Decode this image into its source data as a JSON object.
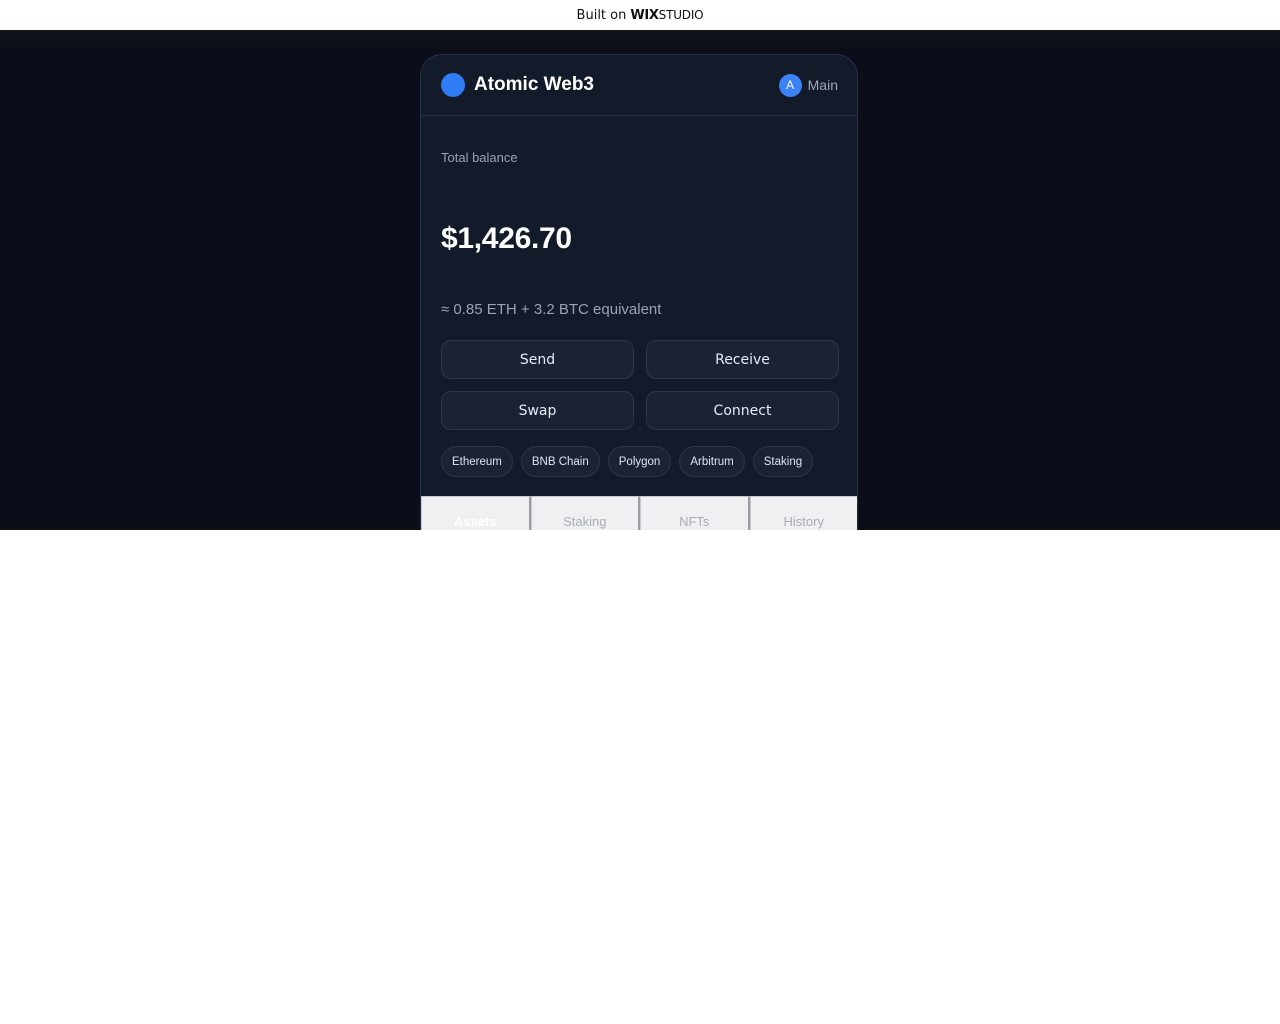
{
  "wix_bar": {
    "prefix": "Built on",
    "brand_bold": "WIX",
    "brand_light": "STUDIO"
  },
  "header": {
    "title": "Atomic Web3",
    "avatar_letter": "A",
    "account_label": "Main"
  },
  "balance": {
    "label": "Total balance",
    "value": "$1,426.70",
    "equivalent": "≈ 0.85 ETH + 3.2 BTC equivalent"
  },
  "actions": [
    "Send",
    "Receive",
    "Swap",
    "Connect"
  ],
  "chains": [
    "Ethereum",
    "BNB Chain",
    "Polygon",
    "Arbitrum",
    "Staking"
  ],
  "tabs": [
    {
      "label": "Assets",
      "active": true
    },
    {
      "label": "Staking",
      "active": false
    },
    {
      "label": "NFTs",
      "active": false
    },
    {
      "label": "History",
      "active": false
    }
  ],
  "colors": {
    "accent": "#2f7cf6",
    "card_bg": "#131a2a",
    "page_bg": "#0b0e18"
  }
}
